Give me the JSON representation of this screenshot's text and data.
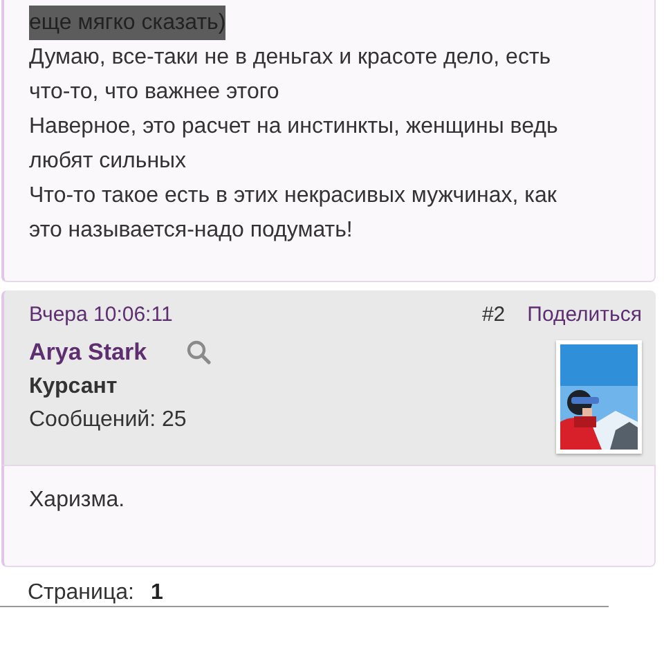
{
  "posts": [
    {
      "paragraphs": [
        {
          "text": "еще мягко сказать)",
          "selected": true
        },
        {
          "text": "Думаю, все-таки не в деньгах и красоте дело, есть что-то, что важнее этого",
          "selected": false
        },
        {
          "text": "Наверное, это расчет на инстинкты, женщины ведь любят сильных",
          "selected": false
        },
        {
          "text": "Что-то такое есть в этих некрасивых мужчинах, как это называется-надо подумать!",
          "selected": false
        }
      ]
    },
    {
      "date": "Вчера 10:06:11",
      "number": "#2",
      "share": "Поделиться",
      "author": "Arya Stark",
      "rank": "Курсант",
      "posts_count": "Сообщений: 25",
      "avatar": {
        "kind": "picture"
      },
      "paragraphs": [
        {
          "text": "Харизма.",
          "selected": false
        }
      ]
    }
  ],
  "pagination": {
    "label": "Страница:",
    "current": "1"
  }
}
